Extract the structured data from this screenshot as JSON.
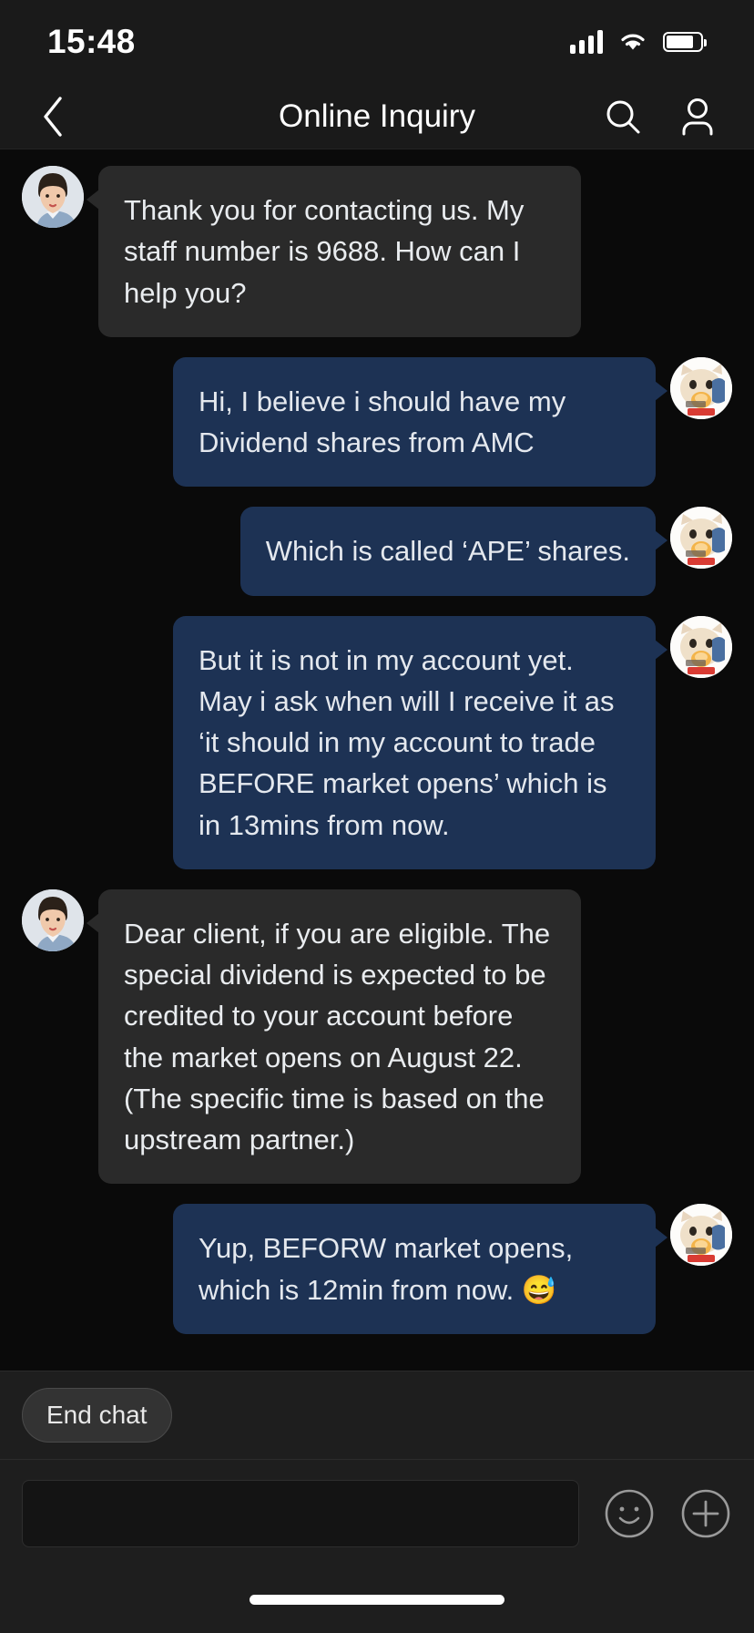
{
  "status_bar": {
    "time": "15:48",
    "cellular_icon": "signal-bars-icon",
    "wifi_icon": "wifi-icon",
    "battery_icon": "battery-icon"
  },
  "nav_bar": {
    "back_icon": "chevron-left-icon",
    "title": "Online Inquiry",
    "search_icon": "search-icon",
    "profile_icon": "person-icon"
  },
  "messages": [
    {
      "id": "m1",
      "sender": "agent",
      "avatar": "agent-avatar-woman",
      "text": "Thank you for contacting us. My staff number is 9688. How can I help you?"
    },
    {
      "id": "m2",
      "sender": "user",
      "avatar": "user-avatar-cat",
      "text": "Hi, I believe i should have my Dividend shares from AMC"
    },
    {
      "id": "m3",
      "sender": "user",
      "avatar": "user-avatar-cat",
      "text": "Which is called ‘APE’ shares."
    },
    {
      "id": "m4",
      "sender": "user",
      "avatar": "user-avatar-cat",
      "text": "But it is not in my account yet. May i ask when will I receive it as ‘it should in my account to trade BEFORE market opens’ which is in 13mins from now."
    },
    {
      "id": "m5",
      "sender": "agent",
      "avatar": "agent-avatar-woman",
      "text": "Dear client, if you are eligible. The special dividend is expected to be credited to your account before the market opens on August 22. (The specific time is based on the upstream partner.)"
    },
    {
      "id": "m6",
      "sender": "user",
      "avatar": "user-avatar-cat",
      "text": "Yup, BEFORW market opens, which is 12min from now. 😅"
    }
  ],
  "footer": {
    "end_chat_label": "End chat",
    "input_value": "",
    "input_placeholder": "",
    "emoji_icon": "smiley-icon",
    "add_icon": "plus-circle-icon"
  },
  "colors": {
    "background": "#0a0a0a",
    "header": "#1a1a1a",
    "agent_bubble": "#2a2a2a",
    "user_bubble": "#1d3254",
    "footer": "#1e1e1e",
    "text": "#e9ecef"
  }
}
